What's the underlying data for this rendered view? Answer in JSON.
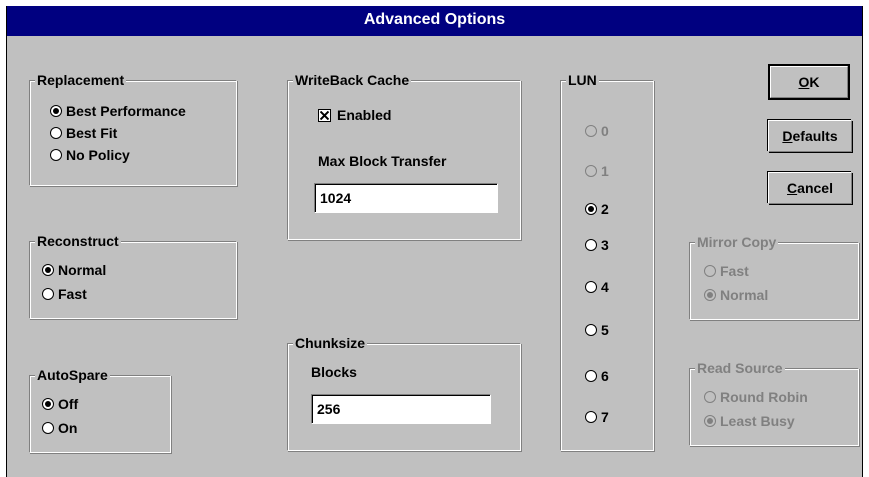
{
  "dialog": {
    "title": "Advanced Options"
  },
  "replacement": {
    "legend": "Replacement",
    "options": [
      {
        "label": "Best Performance",
        "selected": true
      },
      {
        "label": "Best Fit",
        "selected": false
      },
      {
        "label": "No Policy",
        "selected": false
      }
    ]
  },
  "reconstruct": {
    "legend": "Reconstruct",
    "options": [
      {
        "label": "Normal",
        "selected": true
      },
      {
        "label": "Fast",
        "selected": false
      }
    ]
  },
  "autospare": {
    "legend": "AutoSpare",
    "options": [
      {
        "label": "Off",
        "selected": true
      },
      {
        "label": "On",
        "selected": false
      }
    ]
  },
  "writeback": {
    "legend": "WriteBack Cache",
    "enabled_label": "Enabled",
    "enabled_checked": true,
    "max_block_label": "Max Block Transfer",
    "max_block_value": "1024"
  },
  "chunksize": {
    "legend": "Chunksize",
    "blocks_label": "Blocks",
    "blocks_value": "256"
  },
  "lun": {
    "legend": "LUN",
    "options": [
      {
        "label": "0",
        "selected": false,
        "disabled": true
      },
      {
        "label": "1",
        "selected": false,
        "disabled": true
      },
      {
        "label": "2",
        "selected": true,
        "disabled": false
      },
      {
        "label": "3",
        "selected": false,
        "disabled": false
      },
      {
        "label": "4",
        "selected": false,
        "disabled": false
      },
      {
        "label": "5",
        "selected": false,
        "disabled": false
      },
      {
        "label": "6",
        "selected": false,
        "disabled": false
      },
      {
        "label": "7",
        "selected": false,
        "disabled": false
      }
    ]
  },
  "buttons": {
    "ok_mnemonic": "O",
    "ok_rest": "K",
    "defaults_mnemonic": "D",
    "defaults_rest": "efaults",
    "cancel_mnemonic": "C",
    "cancel_rest": "ancel"
  },
  "mirror_copy": {
    "legend": "Mirror Copy",
    "disabled": true,
    "options": [
      {
        "label": "Fast",
        "selected": false
      },
      {
        "label": "Normal",
        "selected": true
      }
    ]
  },
  "read_source": {
    "legend": "Read Source",
    "disabled": true,
    "options": [
      {
        "label": "Round Robin",
        "selected": false
      },
      {
        "label": "Least Busy",
        "selected": true
      }
    ]
  },
  "colors": {
    "title_bar": "#000080",
    "face": "#c0c0c0",
    "disabled_text": "#808080"
  }
}
